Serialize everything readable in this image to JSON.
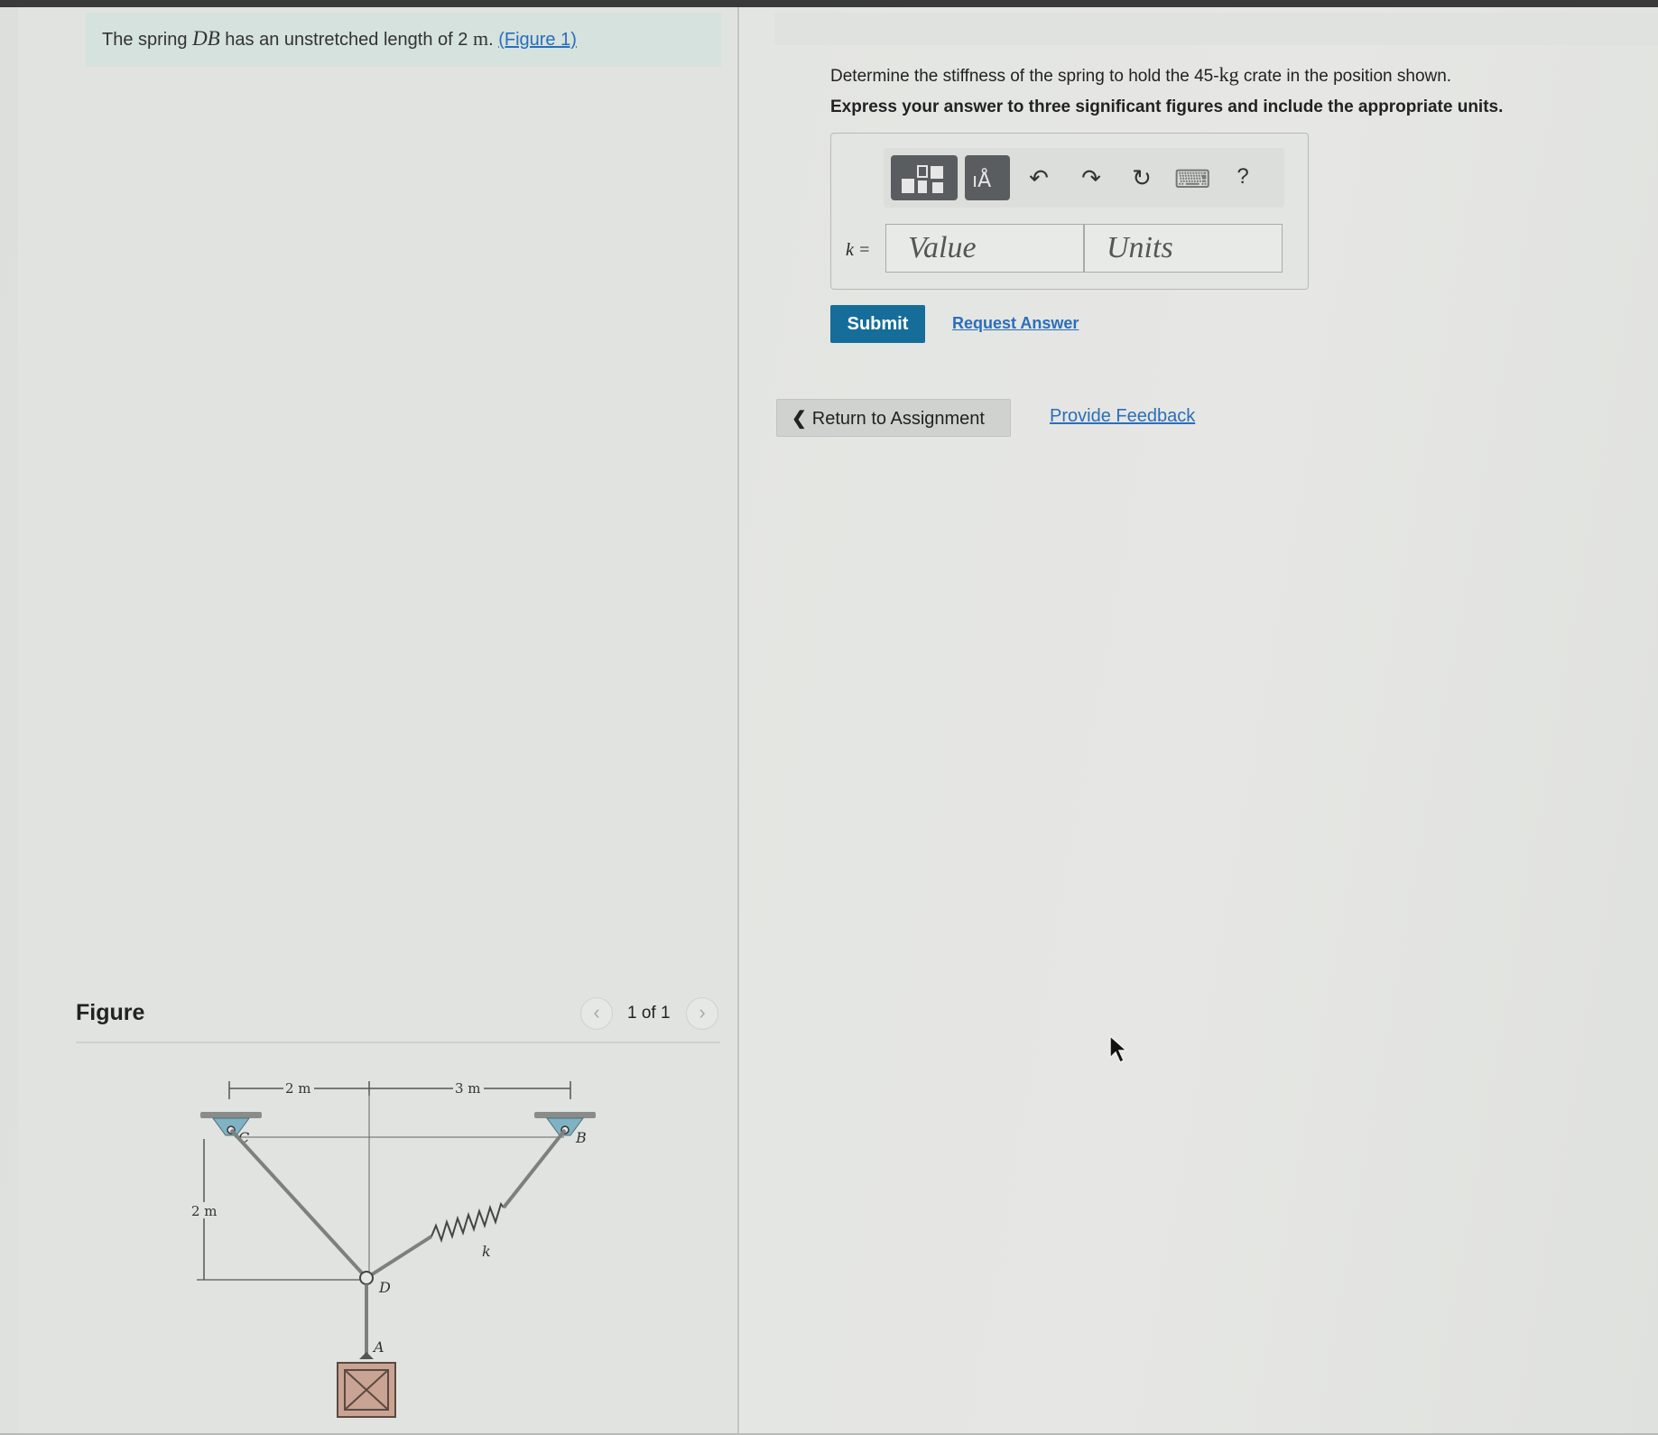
{
  "problem": {
    "intro_prefix": "The spring ",
    "intro_spring": "DB",
    "intro_middle": " has an unstretched length of 2 ",
    "intro_unit": "m",
    "intro_suffix": ". ",
    "figure_link": "(Figure 1)"
  },
  "figure": {
    "title": "Figure",
    "counter": "1 of 1",
    "prev_glyph": "‹",
    "next_glyph": "›",
    "labels": {
      "dim_cd": "2 m",
      "dim_db": "3 m",
      "dim_vertical": "2 m",
      "point_c": "C",
      "point_b": "B",
      "point_d": "D",
      "point_a": "A",
      "spring_k": "k"
    }
  },
  "question": {
    "prefix": "Determine the stiffness of the spring to hold the 45-",
    "unit": "kg",
    "suffix": " crate in the position shown.",
    "instruction": "Express your answer to three significant figures and include the appropriate units."
  },
  "answer": {
    "label": "k =",
    "value_placeholder": "Value",
    "units_placeholder": "Units",
    "toolbar": {
      "templates_icon": "templates-icon",
      "units_icon": "units-icon",
      "units_glyph": "ıÅ",
      "undo_glyph": "↶",
      "redo_glyph": "↷",
      "reset_glyph": "↻",
      "keyboard_glyph": "⌨",
      "help_glyph": "?"
    }
  },
  "actions": {
    "submit": "Submit",
    "request_answer": "Request Answer",
    "return_glyph": "❮",
    "return_label": "Return to Assignment",
    "feedback": "Provide Feedback"
  },
  "colors": {
    "link": "#2a6ebb",
    "submit_bg": "#166d99",
    "intro_bg": "#d5e2de",
    "support_fill": "#7fb3c4"
  }
}
